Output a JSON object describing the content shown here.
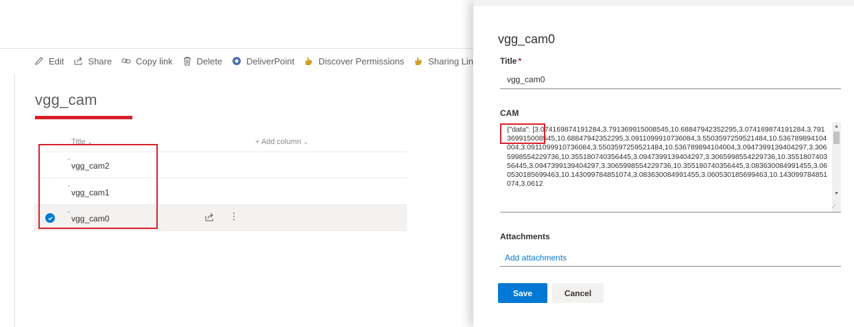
{
  "commands": [
    {
      "label": "Edit",
      "icon": "pencil-icon"
    },
    {
      "label": "Share",
      "icon": "share-icon"
    },
    {
      "label": "Copy link",
      "icon": "link-icon"
    },
    {
      "label": "Delete",
      "icon": "trash-icon"
    },
    {
      "label": "DeliverPoint",
      "icon": "deliverpoint-icon"
    },
    {
      "label": "Discover Permissions",
      "icon": "hand-icon"
    },
    {
      "label": "Sharing Links",
      "icon": "hand-icon"
    }
  ],
  "list": {
    "title": "vgg_cam",
    "columns": {
      "title": "Title",
      "add_column": "+ Add column"
    },
    "rows": [
      {
        "name": "vgg_cam2",
        "selected": false
      },
      {
        "name": "vgg_cam1",
        "selected": false
      },
      {
        "name": "vgg_cam0",
        "selected": true
      }
    ]
  },
  "panel": {
    "title": "vgg_cam0",
    "title_field": {
      "label": "Title",
      "required_mark": "*",
      "value": "vgg_cam0"
    },
    "cam_field": {
      "label": "CAM",
      "value": "{\"data\": [3.074169874191284,3.791369915008545,10.68847942352295,3.074169874191284,3.791369915008545,10.68847942352295,3.0911099910736084,3.5503597259521484,10.536789894104004,3.0911099910736084,3.5503597259521484,10.536789894104004,3.0947399139404297,3.3065998554229736,10.355180740356445,3.0947399139404297,3.3065998554229736,10.355180740356445,3.0947399139404297,3.3065998554229736,10.355180740356445,3.083630084991455,3.060530185699463,10.143099784851074,3.083630084991455,3.060530185699463,10.143099784851074,3.0612"
    },
    "attachments": {
      "label": "Attachments",
      "link": "Add attachments"
    },
    "buttons": {
      "save": "Save",
      "cancel": "Cancel"
    }
  },
  "colors": {
    "accent": "#0078d4",
    "highlight": "#d81f2a"
  }
}
